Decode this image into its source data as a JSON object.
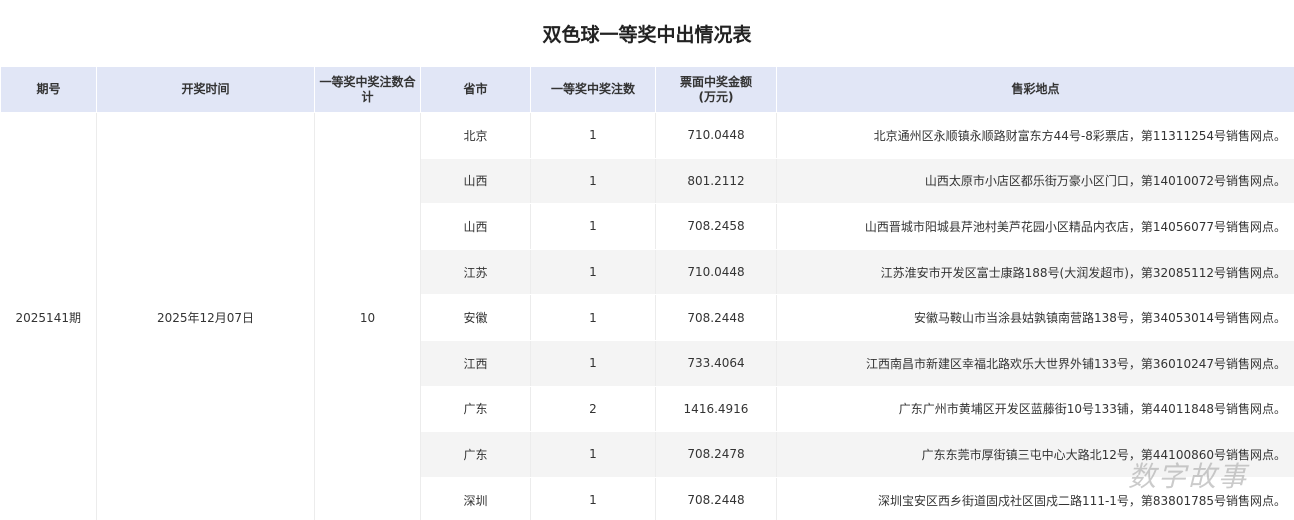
{
  "title": "双色球一等奖中出情况表",
  "columns": [
    "期号",
    "开奖时间",
    "一等奖中奖注数合计",
    "省市",
    "一等奖中奖注数",
    "票面中奖金额\n(万元)",
    "售彩地点"
  ],
  "issue": "2025141期",
  "draw_date": "2025年12月07日",
  "total_winners": "10",
  "rows": [
    {
      "province": "北京",
      "count": "1",
      "amount": "710.0448",
      "location": "北京通州区永顺镇永顺路财富东方44号-8彩票店，第11311254号销售网点。"
    },
    {
      "province": "山西",
      "count": "1",
      "amount": "801.2112",
      "location": "山西太原市小店区都乐街万豪小区门口，第14010072号销售网点。"
    },
    {
      "province": "山西",
      "count": "1",
      "amount": "708.2458",
      "location": "山西晋城市阳城县芹池村美芦花园小区精品内衣店，第14056077号销售网点。"
    },
    {
      "province": "江苏",
      "count": "1",
      "amount": "710.0448",
      "location": "江苏淮安市开发区富士康路188号(大润发超市)，第32085112号销售网点。"
    },
    {
      "province": "安徽",
      "count": "1",
      "amount": "708.2448",
      "location": "安徽马鞍山市当涂县姑孰镇南营路138号，第34053014号销售网点。"
    },
    {
      "province": "江西",
      "count": "1",
      "amount": "733.4064",
      "location": "江西南昌市新建区幸福北路欢乐大世界外铺133号，第36010247号销售网点。"
    },
    {
      "province": "广东",
      "count": "2",
      "amount": "1416.4916",
      "location": "广东广州市黄埔区开发区蓝藤街10号133铺，第44011848号销售网点。"
    },
    {
      "province": "广东",
      "count": "1",
      "amount": "708.2478",
      "location": "广东东莞市厚街镇三屯中心大路北12号，第44100860号销售网点。"
    },
    {
      "province": "深圳",
      "count": "1",
      "amount": "708.2448",
      "location": "深圳宝安区西乡街道固戍社区固戍二路111-1号，第83801785号销售网点。"
    }
  ],
  "watermark": "数字故事"
}
